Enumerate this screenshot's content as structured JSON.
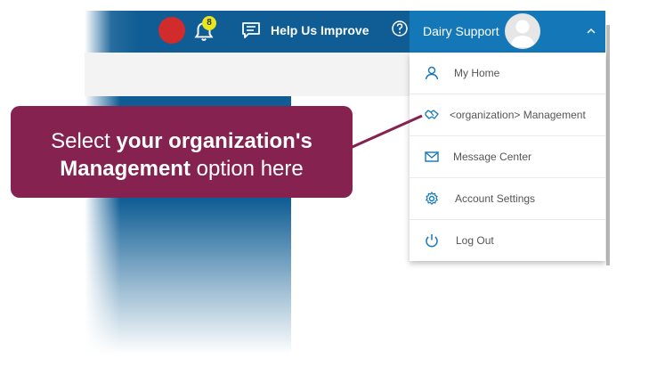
{
  "header": {
    "notification_count": "8",
    "help_label": "Help Us Improve",
    "user_name": "Dairy Support"
  },
  "dropdown": {
    "items": [
      {
        "label": "My Home",
        "icon": "person-icon"
      },
      {
        "label": "<organization> Management",
        "icon": "handshake-icon"
      },
      {
        "label": "Message Center",
        "icon": "envelope-icon"
      },
      {
        "label": "Account Settings",
        "icon": "gear-icon"
      },
      {
        "label": "Log Out",
        "icon": "power-icon"
      }
    ]
  },
  "callout": {
    "line1_plain": "Select ",
    "line1_bold": "your organization's",
    "line2_bold": "Management",
    "line2_plain": " option here"
  },
  "colors": {
    "header_blue": "#0f5d94",
    "user_blue": "#1478b8",
    "callout": "#85224f",
    "badge": "#e9e61b",
    "icon_blue": "#1478b8"
  }
}
